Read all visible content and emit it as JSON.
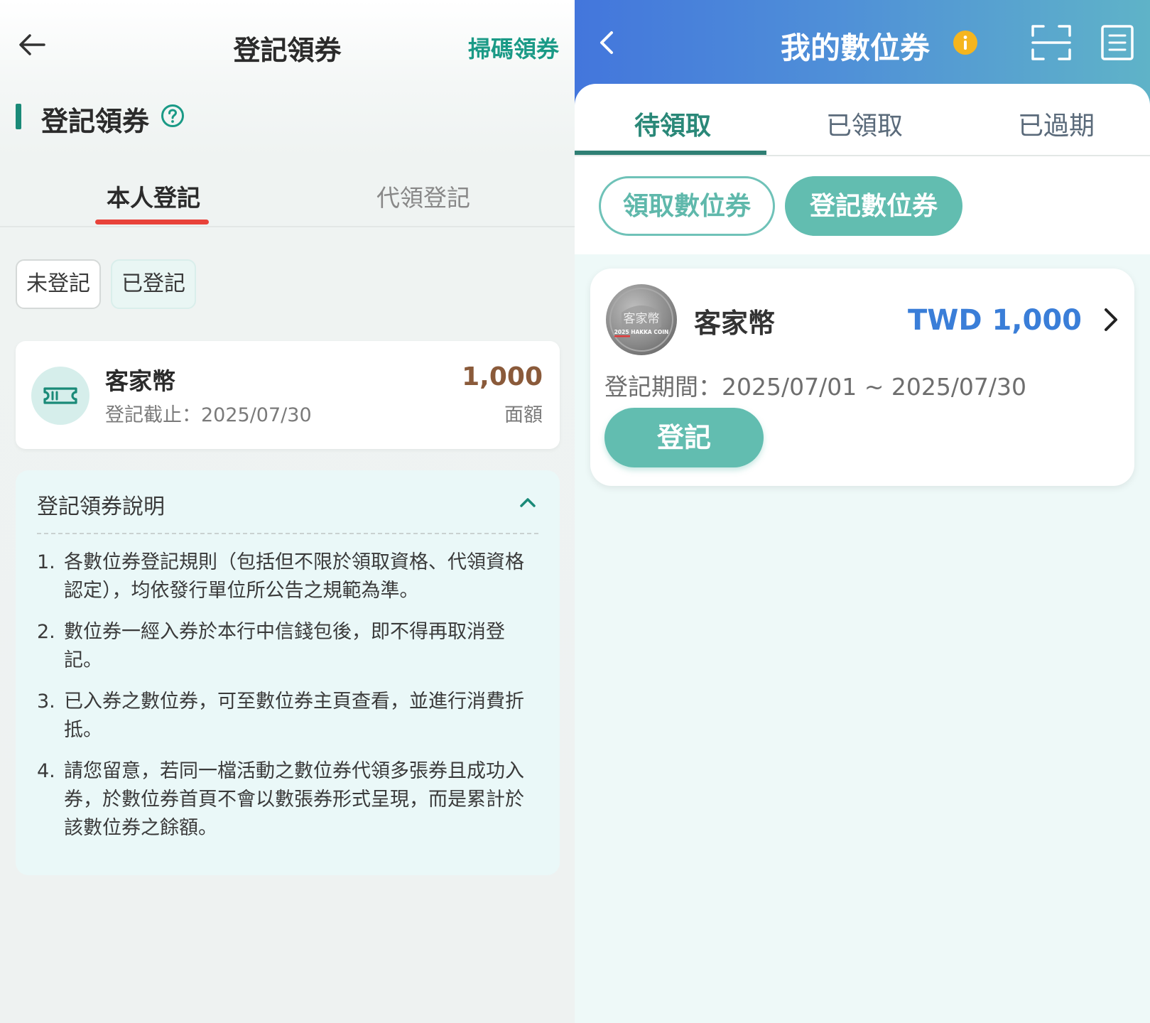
{
  "left": {
    "header": {
      "title": "登記領券",
      "scan_label": "掃碼領券"
    },
    "section_title": "登記領券",
    "tabs": [
      {
        "label": "本人登記"
      },
      {
        "label": "代領登記"
      }
    ],
    "filters": [
      {
        "label": "未登記"
      },
      {
        "label": "已登記"
      }
    ],
    "coupon": {
      "name": "客家幣",
      "deadline": "登記截止：2025/07/30",
      "amount": "1,000",
      "unit": "面額"
    },
    "instructions": {
      "title": "登記領券說明",
      "items": [
        {
          "num": "1.",
          "text": "各數位券登記規則（包括但不限於領取資格、代領資格認定），均依發行單位所公告之規範為準。"
        },
        {
          "num": "2.",
          "text": "數位券一經入券於本行中信錢包後，即不得再取消登記。"
        },
        {
          "num": "3.",
          "text": "已入券之數位券，可至數位券主頁查看，並進行消費折抵。"
        },
        {
          "num": "4.",
          "text": "請您留意，若同一檔活動之數位券代領多張券且成功入券，於數位券首頁不會以數張券形式呈現，而是累計於該數位券之餘額。"
        }
      ]
    }
  },
  "right": {
    "header": {
      "title": "我的數位券"
    },
    "tabs": [
      {
        "label": "待領取"
      },
      {
        "label": "已領取"
      },
      {
        "label": "已過期"
      }
    ],
    "pills": [
      {
        "label": "領取數位券"
      },
      {
        "label": "登記數位券"
      }
    ],
    "card": {
      "coin_text": "客家幣",
      "coin_subtext": "2025 HAKKA COIN",
      "name": "客家幣",
      "amount": "TWD 1,000",
      "period": "登記期間：2025/07/01 ~ 2025/07/30",
      "button": "登記"
    }
  },
  "colors": {
    "teal": "#1a9a86",
    "red_underline": "#e8423a",
    "amount_brown": "#8a5a3a",
    "amount_blue": "#3a7ed8",
    "pill_teal": "#62bdb0"
  }
}
